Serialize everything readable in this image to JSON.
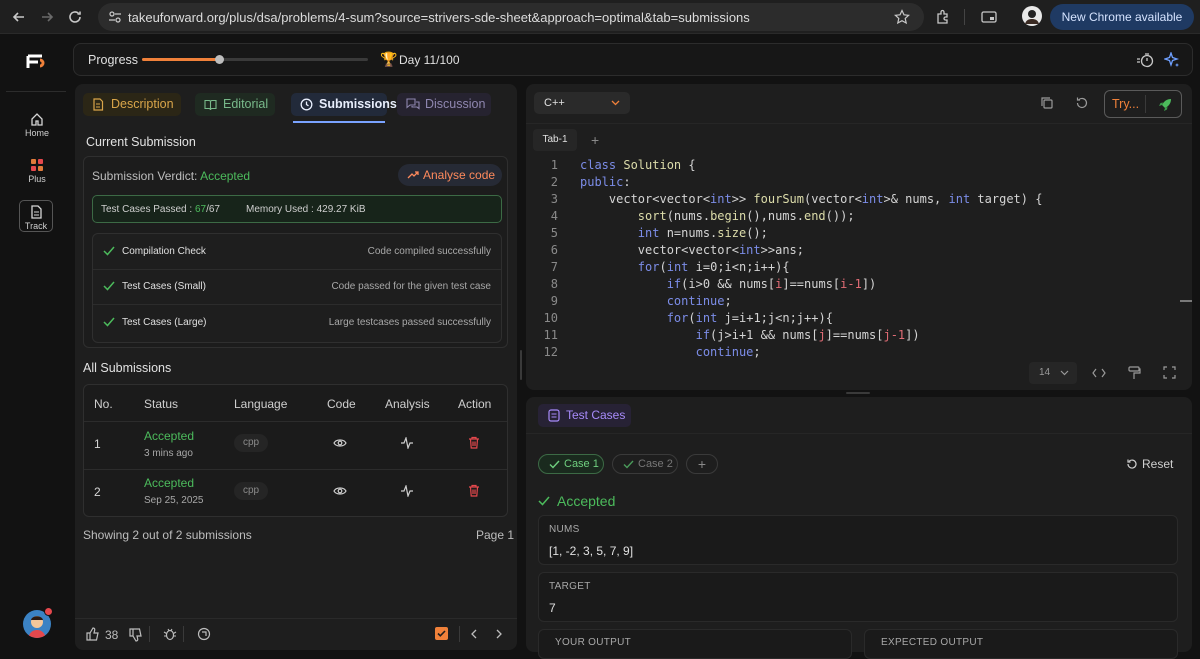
{
  "browser": {
    "url": "takeuforward.org/plus/dsa/problems/4-sum?source=strivers-sde-sheet&approach=optimal&tab=submissions",
    "update_label": "New Chrome available"
  },
  "sidebar": {
    "items": [
      {
        "label": "Home"
      },
      {
        "label": "Plus"
      },
      {
        "label": "Track"
      }
    ]
  },
  "progress": {
    "label": "Progress",
    "value": 0.34,
    "day_label": "Day 11/100"
  },
  "tabs": [
    {
      "label": "Description"
    },
    {
      "label": "Editorial"
    },
    {
      "label": "Submissions"
    },
    {
      "label": "Discussion"
    }
  ],
  "current_submission": {
    "heading": "Current Submission",
    "verdict_label": "Submission Verdict:",
    "verdict": "Accepted",
    "analyse_label": "Analyse code",
    "test_cases_label": "Test Cases Passed :",
    "test_cases_passed": "67",
    "test_cases_total": "/67",
    "memory_label": "Memory Used : 429.27 KiB",
    "checks": [
      {
        "name": "Compilation Check",
        "result": "Code compiled successfully"
      },
      {
        "name": "Test Cases (Small)",
        "result": "Code passed for the given test case"
      },
      {
        "name": "Test Cases (Large)",
        "result": "Large testcases passed successfully"
      }
    ]
  },
  "all_submissions": {
    "heading": "All Submissions",
    "columns": [
      "No.",
      "Status",
      "Language",
      "Code",
      "Analysis",
      "Action"
    ],
    "rows": [
      {
        "no": "1",
        "status": "Accepted",
        "time": "3 mins ago",
        "language": "cpp"
      },
      {
        "no": "2",
        "status": "Accepted",
        "time": "Sep 25, 2025",
        "language": "cpp"
      }
    ],
    "summary": "Showing 2 out of 2 submissions",
    "page": "Page 1"
  },
  "footer": {
    "likes": "38"
  },
  "editor": {
    "language": "C++",
    "try_label": "Try...",
    "tab_name": "Tab-1",
    "font_size": "14",
    "line_numbers": [
      "1",
      "2",
      "3",
      "4",
      "5",
      "6",
      "7",
      "8",
      "9",
      "10",
      "11",
      "12"
    ]
  },
  "test_cases": {
    "title": "Test Cases",
    "cases": [
      {
        "label": "Case 1"
      },
      {
        "label": "Case 2"
      }
    ],
    "reset_label": "Reset",
    "status": "Accepted",
    "nums_label": "NUMS",
    "nums_value": "[1, -2, 3, 5, 7, 9]",
    "target_label": "TARGET",
    "target_value": "7",
    "your_output_label": "YOUR OUTPUT",
    "expected_output_label": "EXPECTED OUTPUT"
  },
  "colors": {
    "accent_orange": "#f0813a",
    "accepted_green": "#4cbb5c",
    "active_tab_blue": "#7aa3ff",
    "delete_red": "#e5484d"
  }
}
